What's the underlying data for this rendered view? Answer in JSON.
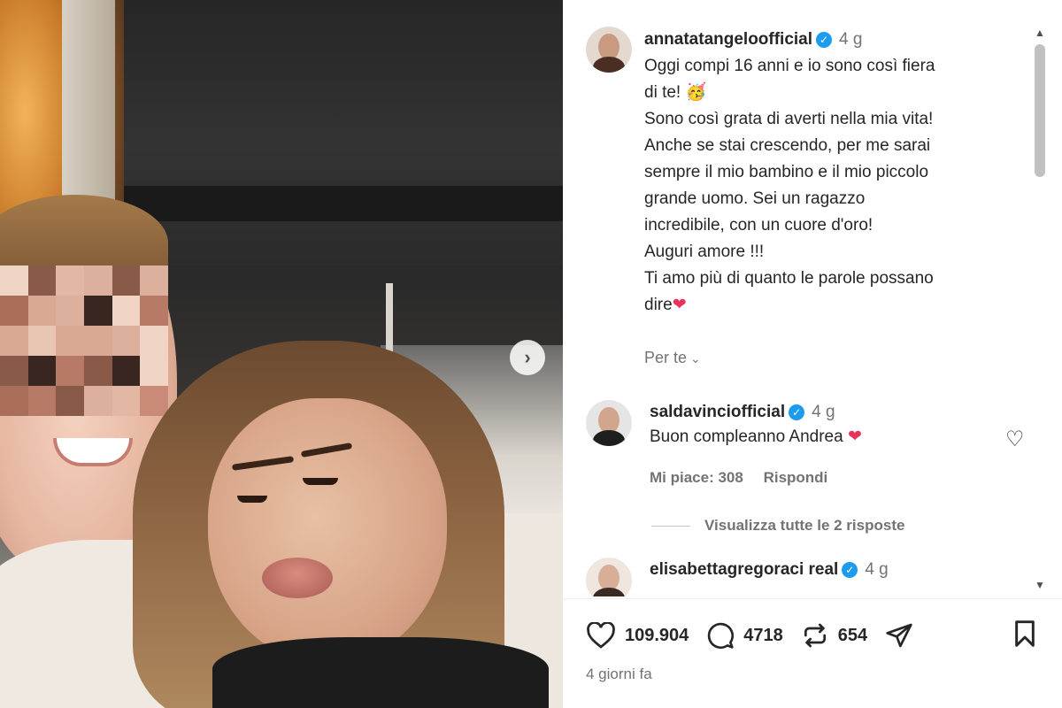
{
  "post": {
    "username": "annatatangeloofficial",
    "time": "4 g",
    "caption_lines": [
      "Oggi compi 16 anni e io sono così fiera",
      "di te!",
      "Sono così grata di averti nella mia vita!",
      "Anche se stai crescendo, per me sarai",
      "sempre il mio bambino e il mio piccolo",
      "grande uomo. Sei un ragazzo",
      "incredibile, con un cuore d'oro!",
      "Auguri amore !!!",
      "Ti amo più di quanto le parole possano",
      "dire"
    ],
    "emoji_partying": "🥳",
    "emoji_heart": "❤",
    "translate_label": "Per te"
  },
  "comments": [
    {
      "username": "saldavinciofficial",
      "time": "4 g",
      "text": "Buon compleanno Andrea",
      "emoji": "❤",
      "likes_label": "Mi piace: 308",
      "reply_label": "Rispondi"
    },
    {
      "username": "elisabettagregoraci real",
      "time": "4 g"
    }
  ],
  "view_replies_label": "Visualizza tutte le 2 risposte",
  "stats": {
    "likes": "109.904",
    "comments": "4718",
    "reposts": "654"
  },
  "date_label": "4 giorni fa",
  "colors": {
    "verified": "#1d9bf0",
    "heart": "#e8345c",
    "muted": "#737373",
    "text": "#262626"
  }
}
